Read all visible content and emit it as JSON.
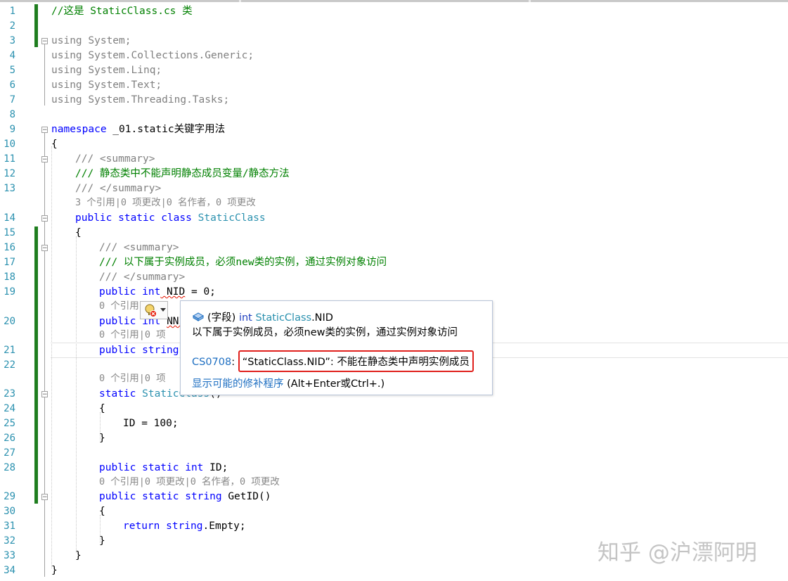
{
  "lines": [
    {
      "n": "1",
      "text": "//这是 StaticClass.cs 类"
    },
    {
      "n": "2",
      "text": ""
    },
    {
      "n": "3",
      "text": "using System;"
    },
    {
      "n": "4",
      "text": "using System.Collections.Generic;"
    },
    {
      "n": "5",
      "text": "using System.Linq;"
    },
    {
      "n": "6",
      "text": "using System.Text;"
    },
    {
      "n": "7",
      "text": "using System.Threading.Tasks;"
    },
    {
      "n": "8",
      "text": ""
    },
    {
      "n": "9",
      "text": "namespace _01.static关键字用法"
    },
    {
      "n": "10",
      "text": "{"
    },
    {
      "n": "11",
      "text": "/// <summary>"
    },
    {
      "n": "12",
      "text": "/// 静态类中不能声明静态成员变量/静态方法"
    },
    {
      "n": "13",
      "text": "/// </summary>"
    },
    {
      "n": "14",
      "text": "public static class StaticClass"
    },
    {
      "n": "15",
      "text": "{"
    },
    {
      "n": "16",
      "text": "/// <summary>"
    },
    {
      "n": "17",
      "text": "/// 以下属于实例成员，必须new类的实例，通过实例对象访问"
    },
    {
      "n": "18",
      "text": "/// </summary>"
    },
    {
      "n": "19",
      "text": "public int NID = 0;"
    },
    {
      "n": "20",
      "text": "public int NNID"
    },
    {
      "n": "21",
      "text": "public string"
    },
    {
      "n": "22",
      "text": ""
    },
    {
      "n": "23",
      "text": "static StaticClass()"
    },
    {
      "n": "24",
      "text": "{"
    },
    {
      "n": "25",
      "text": "ID = 100;"
    },
    {
      "n": "26",
      "text": "}"
    },
    {
      "n": "27",
      "text": ""
    },
    {
      "n": "28",
      "text": "public static int ID;"
    },
    {
      "n": "29",
      "text": "public static string GetID()"
    },
    {
      "n": "30",
      "text": "{"
    },
    {
      "n": "31",
      "text": "return string.Empty;"
    },
    {
      "n": "32",
      "text": "}"
    },
    {
      "n": "33",
      "text": "}"
    },
    {
      "n": "34",
      "text": "}"
    }
  ],
  "tokens": {
    "l1": "//这是 StaticClass.cs 类",
    "using": "using",
    "l3": "System;",
    "l4": "System.Collections.Generic;",
    "l5": "System.Linq;",
    "l6": "System.Text;",
    "l7": "System.Threading.Tasks;",
    "namespace": "namespace",
    "l9": " _01.static关键字用法",
    "brace_open": "{",
    "brace_close": "}",
    "doc_open": "/// <summary>",
    "l12": "/// 静态类中不能声明静态成员变量/静态方法",
    "doc_close": "/// </summary>",
    "l14_kw": "public static class ",
    "l14_type": "StaticClass",
    "l17": "/// 以下属于实例成员，必须new类的实例，通过实例对象访问",
    "public": "public",
    "int": "int",
    "nid_before": " NID",
    "nid_after": " = 0;",
    "nnid": "NNI",
    "string": "string",
    "static": "static",
    "l23_type": "StaticClass",
    "l23_rest": "()",
    "l25": "ID = 100;",
    "l28_kw": "public static int ",
    "l28_rest": "ID;",
    "l29_kw": "public static string ",
    "l29_rest": "GetID()",
    "return": "return",
    "l31_kw2": " string",
    "l31_rest": ".Empty;"
  },
  "codelens": {
    "class_refs": "3 个引用|0 项更改|0 名作者，0 项更改",
    "field_refs_1": "0 个引用",
    "field_refs_2": "0 个引用|0 项",
    "ctor_refs": "0 个引用|0 项",
    "method_refs": "0 个引用|0 项更改|0 名作者，0 项更改"
  },
  "tooltip": {
    "kind": "(字段) ",
    "type_kw": "int",
    "member_class": "StaticClass",
    "member_name": ".NID",
    "doc": "以下属于实例成员，必须new类的实例，通过实例对象访问",
    "error_code": "CS0708",
    "error_sep": ": ",
    "error_message": "“StaticClass.NID”: 不能在静态类中声明实例成员",
    "fix_link": "显示可能的修补程序",
    "fix_shortcut": " (Alt+Enter或Ctrl+.)"
  },
  "icons": {
    "lightbulb": "lightbulb-error-icon",
    "field": "field-icon",
    "dropdown": "chevron-down-icon"
  },
  "colors": {
    "keyword": "#0000ff",
    "comment": "#008000",
    "type": "#2b91af",
    "line_number": "#2b91af",
    "change_bar": "#1f7e1f",
    "error_box": "#e0201c",
    "link": "#1e6fc2"
  },
  "watermark": "知乎 @沪漂阿明"
}
